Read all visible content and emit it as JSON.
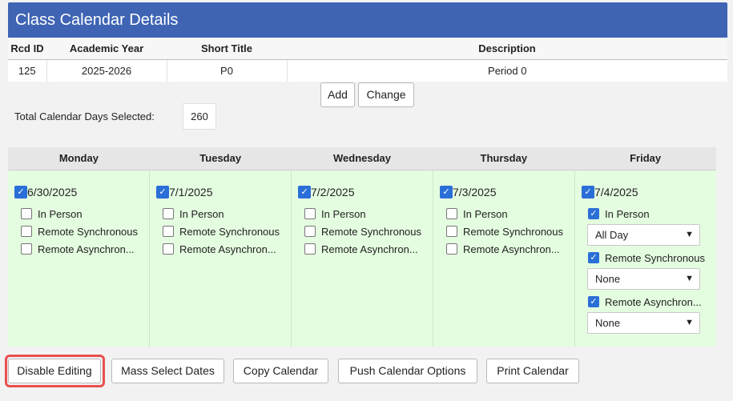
{
  "panel": {
    "title": "Class Calendar Details"
  },
  "info_table": {
    "headers": [
      "Rcd ID",
      "Academic Year",
      "Short Title",
      "Description"
    ],
    "row": [
      "125",
      "2025-2026",
      "P0",
      "Period 0"
    ]
  },
  "actions": {
    "add": "Add",
    "change": "Change"
  },
  "total": {
    "label": "Total Calendar Days Selected:",
    "value": "260"
  },
  "week": {
    "days": [
      {
        "name": "Monday",
        "date": "6/30/2025",
        "checked": true,
        "options": [
          {
            "label": "In Person",
            "checked": false
          },
          {
            "label": "Remote Synchronous",
            "checked": false
          },
          {
            "label": "Remote Asynchron...",
            "checked": false
          }
        ]
      },
      {
        "name": "Tuesday",
        "date": "7/1/2025",
        "checked": true,
        "options": [
          {
            "label": "In Person",
            "checked": false
          },
          {
            "label": "Remote Synchronous",
            "checked": false
          },
          {
            "label": "Remote Asynchron...",
            "checked": false
          }
        ]
      },
      {
        "name": "Wednesday",
        "date": "7/2/2025",
        "checked": true,
        "options": [
          {
            "label": "In Person",
            "checked": false
          },
          {
            "label": "Remote Synchronous",
            "checked": false
          },
          {
            "label": "Remote Asynchron...",
            "checked": false
          }
        ]
      },
      {
        "name": "Thursday",
        "date": "7/3/2025",
        "checked": true,
        "options": [
          {
            "label": "In Person",
            "checked": false
          },
          {
            "label": "Remote Synchronous",
            "checked": false
          },
          {
            "label": "Remote Asynchron...",
            "checked": false
          }
        ]
      },
      {
        "name": "Friday",
        "date": "7/4/2025",
        "checked": true,
        "options": [
          {
            "label": "In Person",
            "checked": true,
            "select": "All Day"
          },
          {
            "label": "Remote Synchronous",
            "checked": true,
            "select": "None"
          },
          {
            "label": "Remote Asynchron...",
            "checked": true,
            "select": "None"
          }
        ]
      }
    ]
  },
  "footer": {
    "disable_editing": "Disable Editing",
    "mass_select": "Mass Select Dates",
    "copy_calendar": "Copy Calendar",
    "push_options": "Push Calendar Options",
    "print_calendar": "Print Calendar"
  },
  "colors": {
    "header": "#3f64b4",
    "calendar_bg": "#e4fde0",
    "checkbox": "#2a6fd8",
    "highlight": "#e8504f"
  }
}
